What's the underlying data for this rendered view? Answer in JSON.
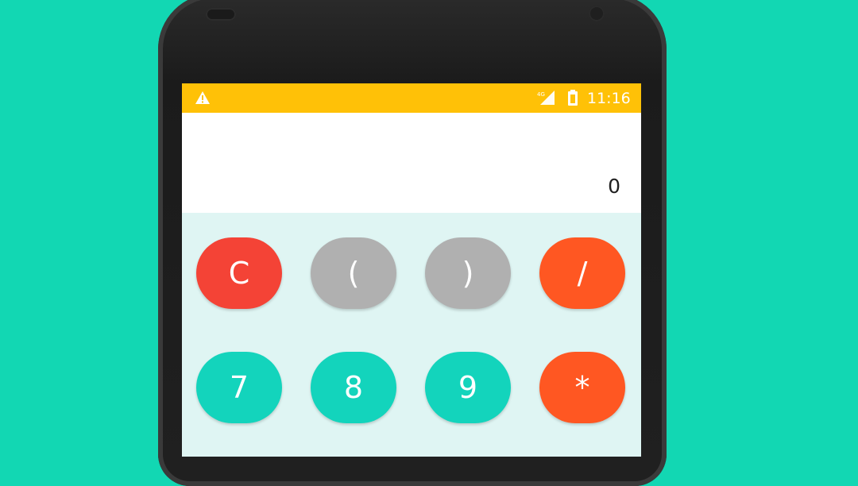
{
  "background_color": "#12d7b3",
  "status_bar": {
    "color": "#ffc107",
    "left_icon": "warning-icon",
    "icons": [
      "signal-4g-icon",
      "battery-icon"
    ],
    "time": "11:16"
  },
  "display": {
    "value": "0"
  },
  "keypad": {
    "rows": [
      [
        {
          "label": "C",
          "color": "#f44336"
        },
        {
          "label": "(",
          "color": "#b0b0b0"
        },
        {
          "label": ")",
          "color": "#b0b0b0"
        },
        {
          "label": "/",
          "color": "#ff5722"
        }
      ],
      [
        {
          "label": "7",
          "color": "#13d4bc"
        },
        {
          "label": "8",
          "color": "#13d4bc"
        },
        {
          "label": "9",
          "color": "#13d4bc"
        },
        {
          "label": "*",
          "color": "#ff5722"
        }
      ]
    ]
  }
}
